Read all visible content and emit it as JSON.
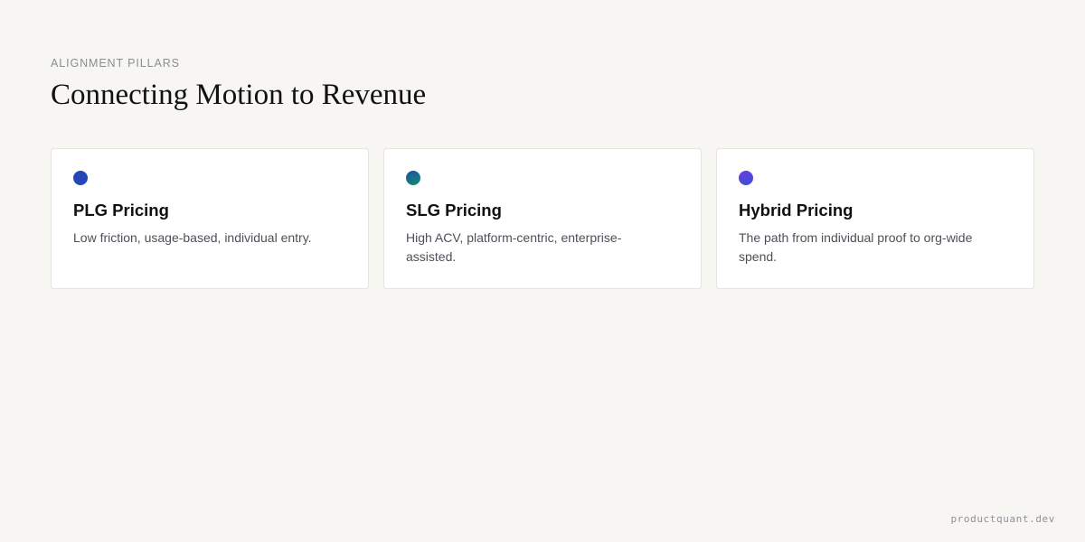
{
  "section": {
    "eyebrow": "ALIGNMENT PILLARS",
    "title": "Connecting Motion to Revenue"
  },
  "cards": [
    {
      "title": "PLG Pricing",
      "description": "Low friction, usage-based, individual entry.",
      "icon": "dot-icon",
      "accent_color_start": "#2447b8",
      "accent_color_end": "#2447b8"
    },
    {
      "title": "SLG Pricing",
      "description": "High ACV, platform-centric, enterprise-assisted.",
      "icon": "dot-icon",
      "accent_color_start": "#1d4ea8",
      "accent_color_end": "#11906a"
    },
    {
      "title": "Hybrid Pricing",
      "description": "The path from individual proof to org-wide spend.",
      "icon": "dot-icon",
      "accent_color_start": "#6a3de0",
      "accent_color_end": "#3a4fd6"
    }
  ],
  "footer": {
    "site": "productquant.dev"
  }
}
